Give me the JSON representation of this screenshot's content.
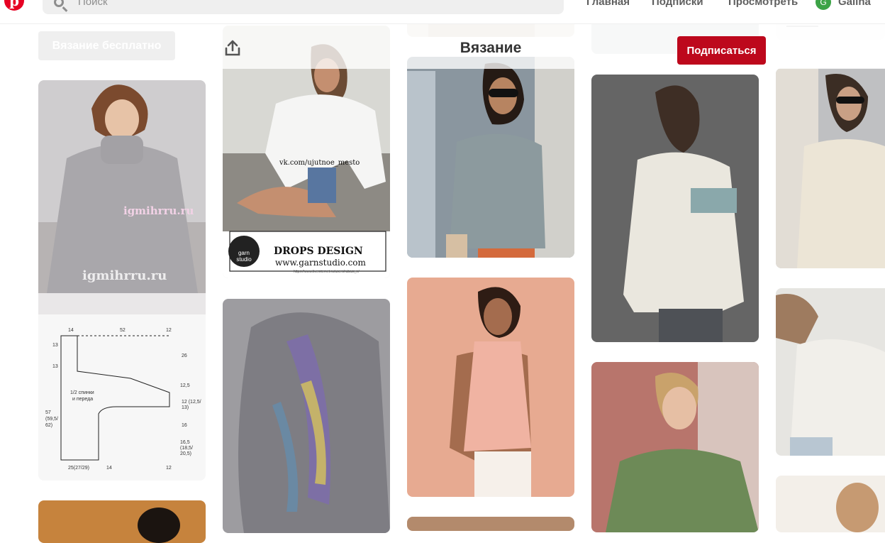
{
  "header": {
    "logo_letter": "p",
    "search_placeholder": "Поиск",
    "nav": {
      "home": "Главная",
      "following": "Подписки",
      "explore": "Просмотреть"
    },
    "user": {
      "initial": "G",
      "name": "Galina"
    }
  },
  "board": {
    "section_pill": "Вязание бесплатно",
    "title": "Вязание",
    "follow_label": "Подписаться"
  },
  "pins": {
    "p1": {
      "watermark_top": "igmihrru.ru",
      "watermark_bottom": "igmihrru.ru"
    },
    "p2": {
      "url_overlay": "vk.com/ujutnoe_mesto",
      "brand": "DROPS DESIGN",
      "brand_site": "www.garnstudio.com",
      "logo_text": "garn studio",
      "source_line": "https://www.liveinternet.ru/users/rubasi_n/"
    }
  },
  "schematic": {
    "labels": [
      "14",
      "52",
      "12",
      "13",
      "26",
      "13",
      "12,5",
      "1/2 спинки и переда",
      "12 (12,5/ 13)",
      "57 (59,5/ 62)",
      "16",
      "16,5 (18,5/ 20,5)",
      "25(27/29)",
      "14",
      "12"
    ],
    "watermark": "igmihrru.ru"
  },
  "colors": {
    "brand": "#e60023",
    "follow_button": "#bd081c",
    "avatar": "#3ca346"
  }
}
